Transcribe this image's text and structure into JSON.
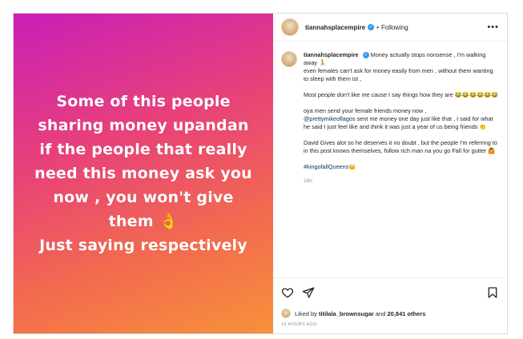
{
  "story": {
    "lines": [
      "Some of this people",
      "sharing money upandan",
      "if the people that really",
      "need this money ask you",
      "now , you won't give",
      "them 👌",
      "Just saying respectively"
    ]
  },
  "header": {
    "username": "tiannahsplacempire",
    "verified_mark": "✓",
    "separator": "•",
    "follow_status": "Following",
    "more": "•••"
  },
  "caption": {
    "username": "tiannahsplacempire",
    "p1": "Money actually stops nonsense , I'm walking away 🏃",
    "p2": "even females can't ask for money easily from men , without them wanting to sleep with them ist ,",
    "p3": "Most people don't like me cause I say things how they are 😂😂😂😂😂😂",
    "p4_a": "oya men send your female friends money now ,",
    "p4_mention": "@prettymikeoflagos",
    "p4_b": " sent me money one day just like that , I said for what he said I just feel like and think it was just a year of us being friends 👏",
    "p5": "David Gives alot so he deserves it no doubt , but the people I'm referring to in this post knows themselves, follow rich man na you go Fall for gutter 🙆",
    "hashtag": "#kingofallQueens👑",
    "time": "16h"
  },
  "footer": {
    "liked_by_prefix": "Liked by ",
    "liked_by_user": "titilala_brownsugar",
    "liked_by_mid": " and ",
    "liked_by_count": "20,841 others",
    "ago": "16 HOURS AGO"
  }
}
